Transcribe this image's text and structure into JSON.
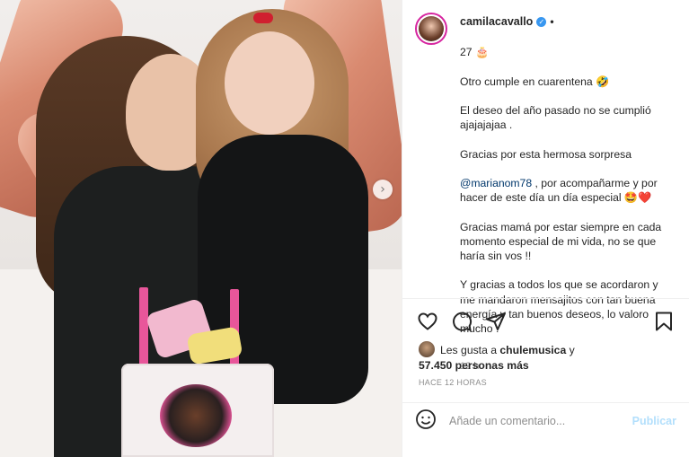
{
  "post": {
    "username": "camilacavallo",
    "verified_icon": "verified-badge-icon",
    "separator": "•",
    "caption_lines": [
      "27 🎂",
      "Otro cumple en cuarentena 🤣",
      "El deseo del año pasado no se cumplió ajajajajaa .",
      "Gracias por esta hermosa sorpresa",
      "@marianom78 , por acompañarme y por hacer de este día un día especial 🤩❤️",
      "Gracias mamá por estar siempre en cada momento especial de mi vida, no se que haría sin vos !!",
      "Y gracias a todos los que se acordaron y me mandaron mensajitos con tan buena energía y tan buenos deseos, lo valoro mucho ."
    ],
    "mention": "@marianom78",
    "caption_time": "12 h"
  },
  "actions": {
    "like_icon": "heart-icon",
    "comment_icon": "comment-icon",
    "share_icon": "share-icon",
    "save_icon": "bookmark-icon"
  },
  "likes": {
    "prefix": "Les gusta a",
    "liker": "chulemusica",
    "joiner": "y",
    "count": "57.450",
    "suffix": "personas más"
  },
  "time_ago": "HACE 12 HORAS",
  "comment": {
    "placeholder": "Añade un comentario...",
    "publish_label": "Publicar"
  },
  "colors": {
    "link": "#00376b",
    "publish_disabled": "#b2dffc",
    "verified": "#3897f0",
    "muted": "#8e8e8e"
  }
}
